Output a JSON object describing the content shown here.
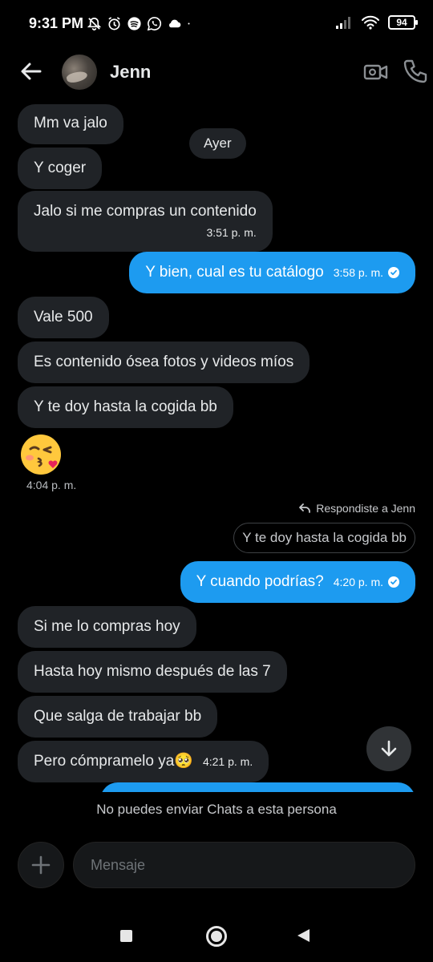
{
  "status_bar": {
    "time": "9:31 PM",
    "battery": "94"
  },
  "header": {
    "contact_name": "Jenn"
  },
  "chat": {
    "day_label": "Ayer",
    "messages": [
      {
        "text": "Mm va jalo"
      },
      {
        "text": "Y coger"
      },
      {
        "text": "Jalo si me compras un contenido",
        "time": "3:51 p. m."
      },
      {
        "text": "Y bien, cual es tu catálogo",
        "time": "3:58 p. m."
      },
      {
        "text": "Vale 500"
      },
      {
        "text": "Es contenido ósea fotos y videos míos"
      },
      {
        "text": "Y te doy hasta la cogida bb"
      },
      {
        "text": "😘",
        "time": "4:04 p. m."
      },
      {
        "text": "Y cuando podrías?",
        "time": "4:20 p. m."
      },
      {
        "text": "Si me lo compras hoy"
      },
      {
        "text": "Hasta hoy mismo después de las 7"
      },
      {
        "text": "Que salga de trabajar bb"
      },
      {
        "text": "Pero cómpramelo ya🥺",
        "time": "4:21 p. m."
      }
    ],
    "reply_label": "Respondiste a Jenn",
    "quoted_text": "Y te doy hasta la cogida bb"
  },
  "footer": {
    "notice": "No puedes enviar Chats a esta persona",
    "input_placeholder": "Mensaje"
  }
}
